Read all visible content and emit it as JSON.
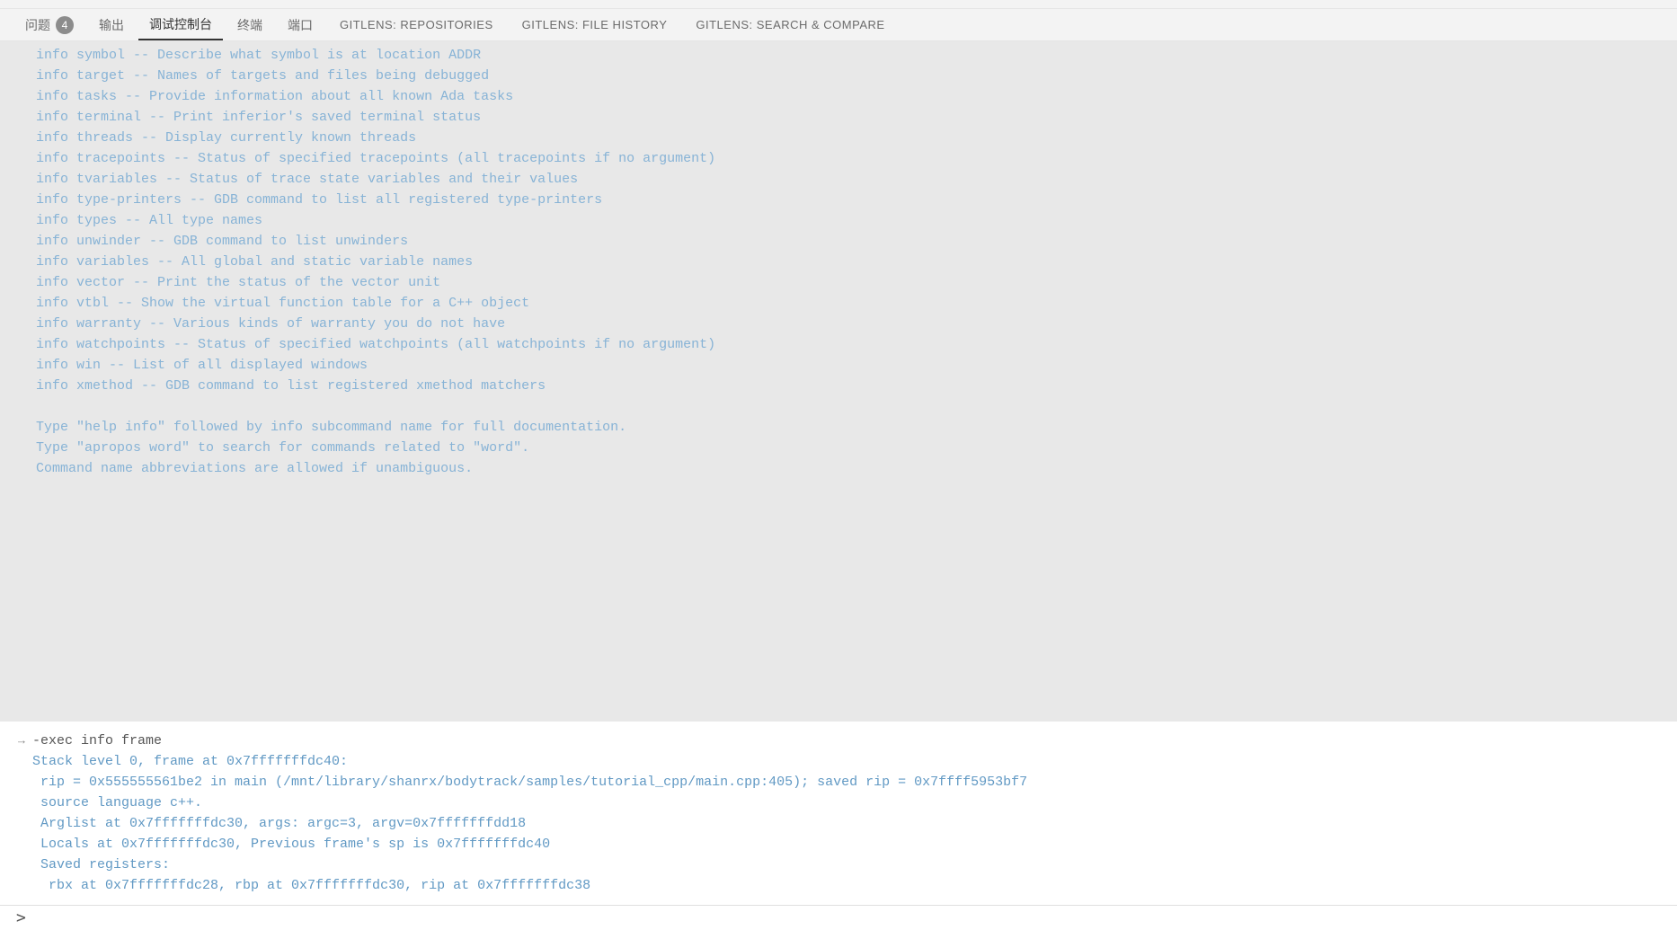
{
  "tabs": {
    "problems": {
      "label": "问题",
      "badge": "4"
    },
    "output": {
      "label": "输出"
    },
    "debug_console": {
      "label": "调试控制台"
    },
    "terminal": {
      "label": "终端"
    },
    "ports": {
      "label": "端口"
    },
    "gitlens_repos": {
      "label": "GITLENS: REPOSITORIES"
    },
    "gitlens_filehist": {
      "label": "GITLENS: FILE HISTORY"
    },
    "gitlens_search": {
      "label": "GITLENS: SEARCH & COMPARE"
    }
  },
  "gdb_output": [
    "info symbol -- Describe what symbol is at location ADDR",
    "info target -- Names of targets and files being debugged",
    "info tasks -- Provide information about all known Ada tasks",
    "info terminal -- Print inferior's saved terminal status",
    "info threads -- Display currently known threads",
    "info tracepoints -- Status of specified tracepoints (all tracepoints if no argument)",
    "info tvariables -- Status of trace state variables and their values",
    "info type-printers -- GDB command to list all registered type-printers",
    "info types -- All type names",
    "info unwinder -- GDB command to list unwinders",
    "info variables -- All global and static variable names",
    "info vector -- Print the status of the vector unit",
    "info vtbl -- Show the virtual function table for a C++ object",
    "info warranty -- Various kinds of warranty you do not have",
    "info watchpoints -- Status of specified watchpoints (all watchpoints if no argument)",
    "info win -- List of all displayed windows",
    "info xmethod -- GDB command to list registered xmethod matchers",
    "",
    "Type \"help info\" followed by info subcommand name for full documentation.",
    "Type \"apropos word\" to search for commands related to \"word\".",
    "Command name abbreviations are allowed if unambiguous."
  ],
  "command": {
    "prompt_arrow": "→",
    "text": "-exec info frame"
  },
  "frame_result": [
    "Stack level 0, frame at 0x7fffffffdc40:",
    " rip = 0x555555561be2 in main (/mnt/library/shanrx/bodytrack/samples/tutorial_cpp/main.cpp:405); saved rip = 0x7ffff5953bf7",
    " source language c++.",
    " Arglist at 0x7fffffffdc30, args: argc=3, argv=0x7fffffffdd18",
    " Locals at 0x7fffffffdc30, Previous frame's sp is 0x7fffffffdc40",
    " Saved registers:",
    "  rbx at 0x7fffffffdc28, rbp at 0x7fffffffdc30, rip at 0x7fffffffdc38"
  ],
  "input_prompt": ">"
}
